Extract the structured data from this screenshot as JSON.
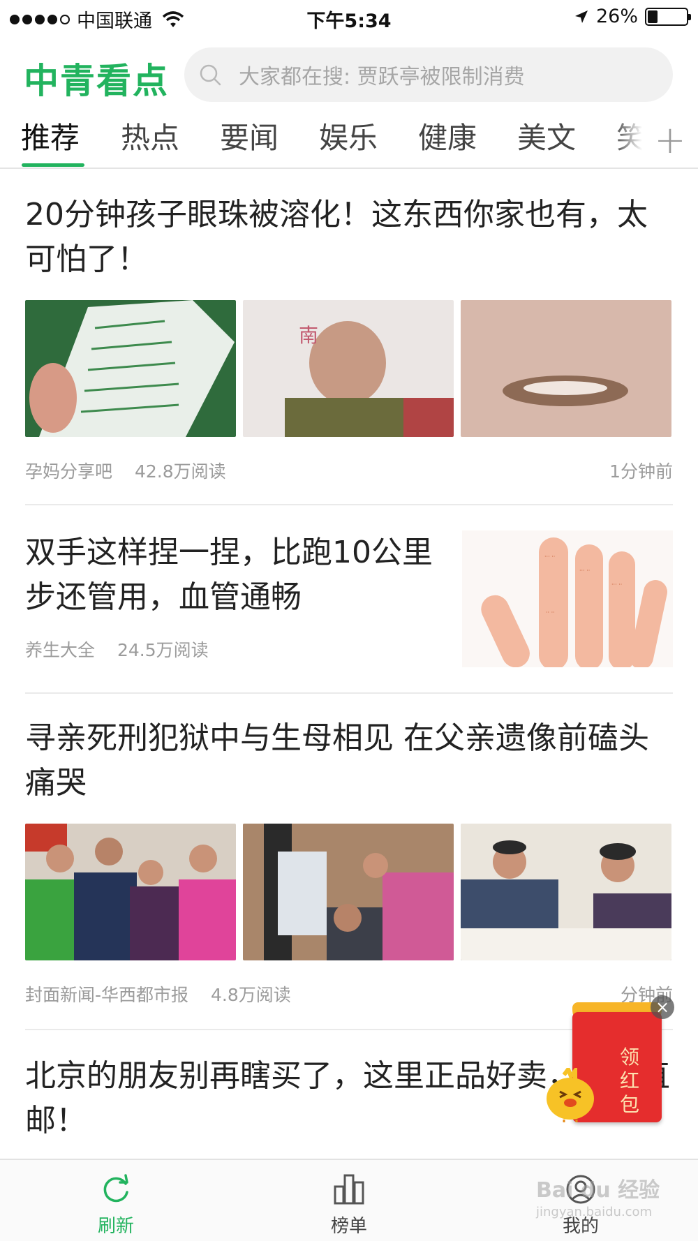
{
  "status_bar": {
    "carrier": "中国联通",
    "time": "下午5:34",
    "battery": "26%",
    "battery_level": 0.26
  },
  "header": {
    "logo": "中青看点",
    "search_placeholder": "大家都在搜: 贾跃亭被限制消费"
  },
  "tabs": [
    {
      "label": "推荐",
      "active": true
    },
    {
      "label": "热点"
    },
    {
      "label": "要闻"
    },
    {
      "label": "娱乐"
    },
    {
      "label": "健康"
    },
    {
      "label": "美文"
    },
    {
      "label": "笑"
    }
  ],
  "tab_add": "+",
  "articles": [
    {
      "title": "20分钟孩子眼珠被溶化！这东西你家也有，太可怕了！",
      "source": "孕妈分享吧",
      "reads": "42.8万阅读",
      "time": "1分钟前"
    },
    {
      "title": "双手这样捏一捏，比跑10公里步还管用，血管通畅",
      "source": "养生大全",
      "reads": "24.5万阅读"
    },
    {
      "title": "寻亲死刑犯狱中与生母相见 在父亲遗像前磕头痛哭",
      "source": "封面新闻-华西都市报",
      "reads": "4.8万阅读",
      "time": "分钟前"
    },
    {
      "title": "北京的朋友别再瞎买了，这里正品好卖，免税直邮！"
    }
  ],
  "red_packet": {
    "label": "领红包",
    "close": "×"
  },
  "bottom_nav": [
    {
      "label": "刷新",
      "icon": "refresh-icon",
      "active": true
    },
    {
      "label": "榜单",
      "icon": "ranking-icon"
    },
    {
      "label": "我的",
      "icon": "profile-icon"
    }
  ],
  "watermark": {
    "line1": "Bai du 经验",
    "line2": "jingyan.baidu.com"
  },
  "colors": {
    "accent": "#22b35e",
    "red_packet": "#e52d2d"
  }
}
